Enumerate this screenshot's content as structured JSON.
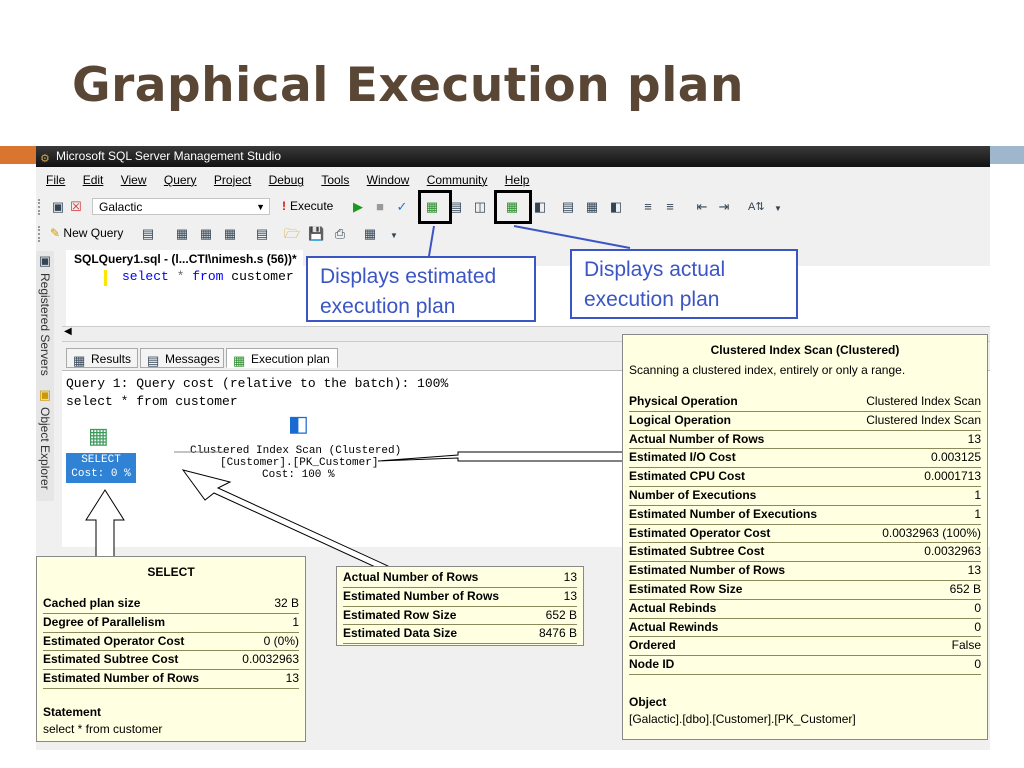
{
  "slide": {
    "title": "Graphical Execution plan"
  },
  "window": {
    "title": "Microsoft SQL Server Management Studio"
  },
  "menu": [
    "File",
    "Edit",
    "View",
    "Query",
    "Project",
    "Debug",
    "Tools",
    "Window",
    "Community",
    "Help"
  ],
  "toolbar": {
    "database": "Galactic",
    "execute_label": "Execute",
    "new_query_label": "New Query"
  },
  "document": {
    "tab_label": "SQLQuery1.sql - (l...CTI\\nimesh.s (56))*",
    "query_kw1": "select",
    "query_star": "*",
    "query_kw2": "from",
    "query_table": "customer"
  },
  "sidebar": {
    "registered_servers": "Registered Servers",
    "object_explorer": "Object Explorer"
  },
  "result_tabs": [
    "Results",
    "Messages",
    "Execution plan"
  ],
  "plan": {
    "line1": "Query 1: Query cost (relative to the batch): 100%",
    "line2": "select * from customer",
    "select_node_label": "SELECT",
    "select_node_cost": "Cost: 0 %",
    "scan_label1": "Clustered Index Scan (Clustered)",
    "scan_label2": "[Customer].[PK_Customer]",
    "scan_label3": "Cost: 100 %"
  },
  "callouts": {
    "estimated": [
      "Displays estimated",
      "execution plan"
    ],
    "actual": [
      "Displays actual",
      "execution plan"
    ]
  },
  "tooltip_select": {
    "title": "SELECT",
    "rows": [
      {
        "k": "Cached plan size",
        "v": "32 B"
      },
      {
        "k": "Degree of Parallelism",
        "v": "1"
      },
      {
        "k": "Estimated Operator Cost",
        "v": "0 (0%)"
      },
      {
        "k": "Estimated Subtree Cost",
        "v": "0.0032963"
      },
      {
        "k": "Estimated Number of Rows",
        "v": "13"
      }
    ],
    "statement_heading": "Statement",
    "statement_text": "select * from customer"
  },
  "tooltip_arrow": {
    "rows": [
      {
        "k": "Actual Number of Rows",
        "v": "13"
      },
      {
        "k": "Estimated Number of Rows",
        "v": "13"
      },
      {
        "k": "Estimated Row Size",
        "v": "652 B"
      },
      {
        "k": "Estimated Data Size",
        "v": "8476 B"
      }
    ]
  },
  "tooltip_scan": {
    "title": "Clustered Index Scan (Clustered)",
    "description": "Scanning a clustered index, entirely or only a range.",
    "rows": [
      {
        "k": "Physical Operation",
        "v": "Clustered Index Scan"
      },
      {
        "k": "Logical Operation",
        "v": "Clustered Index Scan"
      },
      {
        "k": "Actual Number of Rows",
        "v": "13"
      },
      {
        "k": "Estimated I/O Cost",
        "v": "0.003125"
      },
      {
        "k": "Estimated CPU Cost",
        "v": "0.0001713"
      },
      {
        "k": "Number of Executions",
        "v": "1"
      },
      {
        "k": "Estimated Number of Executions",
        "v": "1"
      },
      {
        "k": "Estimated Operator Cost",
        "v": "0.0032963 (100%)"
      },
      {
        "k": "Estimated Subtree Cost",
        "v": "0.0032963"
      },
      {
        "k": "Estimated Number of Rows",
        "v": "13"
      },
      {
        "k": "Estimated Row Size",
        "v": "652 B"
      },
      {
        "k": "Actual Rebinds",
        "v": "0"
      },
      {
        "k": "Actual Rewinds",
        "v": "0"
      },
      {
        "k": "Ordered",
        "v": "False"
      },
      {
        "k": "Node ID",
        "v": "0"
      }
    ],
    "object_heading": "Object",
    "object_text": "[Galactic].[dbo].[Customer].[PK_Customer]"
  },
  "colors": {
    "title": "#5a4634",
    "accent_orange": "#d9752e",
    "accent_blue": "#9fb7cc",
    "callout_blue": "#3c55c4",
    "tooltip_bg": "#ffffe1",
    "node_blue": "#2f82d4"
  }
}
